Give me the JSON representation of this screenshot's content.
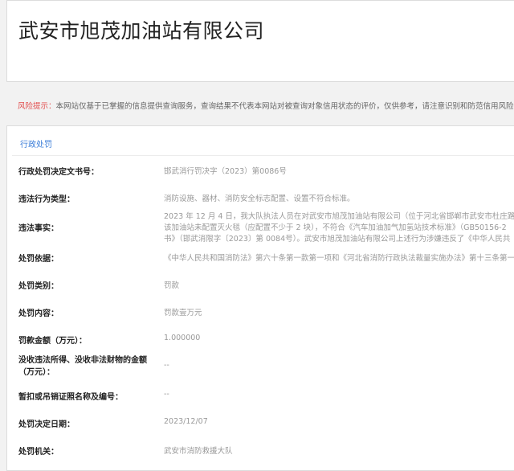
{
  "company": {
    "name": "武安市旭茂加油站有限公司"
  },
  "risk": {
    "label": "风险提示：",
    "text": "本网站仅基于已掌握的信息提供查询服务，查询结果不代表本网站对被查询对象信用状态的评价，仅供参考，请注意识别和防范信用风险"
  },
  "section": {
    "title": "行政处罚"
  },
  "fields": [
    {
      "label": "行政处罚决定文书号：",
      "value": "邯武消行罚决字（2023）第0086号"
    },
    {
      "label": "违法行为类型：",
      "value": "消防设施、器材、消防安全标志配置、设置不符合标准。"
    },
    {
      "label": "违法事实：",
      "value_lines": [
        "2023 年 12 月 4 日，我大队执法人员在对武安市旭茂加油站有限公司（位于河北省邯郸市武安市杜庄路",
        "该加油站未配置灭火毯（应配置不少于 2 块），不符合《汽车加油加气加氢站技术标准》（GB50156-2",
        "书》（邯武消限字〔2023〕第 0084号）。武安市旭茂加油站有限公司上述行为涉嫌违反了《中华人民共"
      ]
    },
    {
      "label": "处罚依据：",
      "value": "《中华人民共和国消防法》第六十条第一款第一项和《河北省消防行政执法裁量实施办法》第十三条第一"
    },
    {
      "label": "处罚类别：",
      "value": "罚款"
    },
    {
      "label": "处罚内容：",
      "value": "罚款壹万元"
    },
    {
      "label": "罚款金额（万元）：",
      "value": "1.000000"
    },
    {
      "label": "没收违法所得、没收非法财物的金额（万元）：",
      "value": "--"
    },
    {
      "label": "暂扣或吊销证照名称及编号：",
      "value": "--"
    },
    {
      "label": "处罚决定日期：",
      "value": "2023/12/07"
    },
    {
      "label": "处罚机关：",
      "value": "武安市消防救援大队"
    }
  ]
}
